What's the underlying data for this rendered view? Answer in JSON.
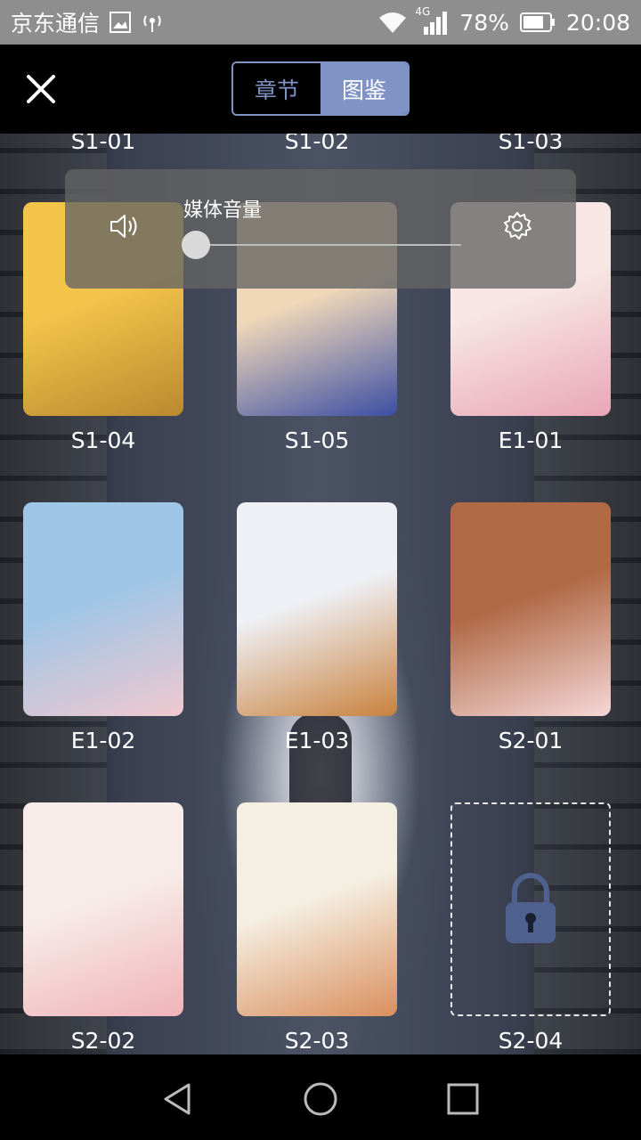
{
  "status_bar": {
    "carrier": "京东通信",
    "network": "4G",
    "battery": "78%",
    "time": "20:08",
    "icons": [
      "image-icon",
      "hotspot-icon",
      "wifi-icon",
      "signal-icon",
      "battery-icon"
    ]
  },
  "header": {
    "close_icon": "close-icon",
    "tabs": [
      {
        "label": "章节",
        "active": false
      },
      {
        "label": "图鉴",
        "active": true
      }
    ]
  },
  "gallery": {
    "top_labels": [
      "S1-01",
      "S1-02",
      "S1-03"
    ],
    "items": [
      {
        "label": "S1-04",
        "locked": false,
        "colors": [
          "#f2c44a",
          "#b98a2e"
        ]
      },
      {
        "label": "S1-05",
        "locked": false,
        "colors": [
          "#f0d7b8",
          "#3b4fa3"
        ]
      },
      {
        "label": "E1-01",
        "locked": false,
        "colors": [
          "#f7e6e3",
          "#e9a6b7"
        ]
      },
      {
        "label": "E1-02",
        "locked": false,
        "colors": [
          "#9fc6e6",
          "#f0c8cf"
        ]
      },
      {
        "label": "E1-03",
        "locked": false,
        "colors": [
          "#eef0f5",
          "#c9813d"
        ]
      },
      {
        "label": "S2-01",
        "locked": false,
        "colors": [
          "#b06a46",
          "#f5d7d7"
        ]
      },
      {
        "label": "S2-02",
        "locked": false,
        "colors": [
          "#f7ece9",
          "#f0b3b8"
        ]
      },
      {
        "label": "S2-03",
        "locked": false,
        "colors": [
          "#f5efe2",
          "#d98f5e"
        ]
      },
      {
        "label": "S2-04",
        "locked": true,
        "icon": "lock-icon"
      }
    ]
  },
  "volume_panel": {
    "title": "媒体音量",
    "speaker_icon": "speaker-icon",
    "settings_icon": "gear-icon",
    "level": 0
  },
  "nav_bar": {
    "icons": [
      "back-icon",
      "home-icon",
      "recents-icon"
    ]
  }
}
